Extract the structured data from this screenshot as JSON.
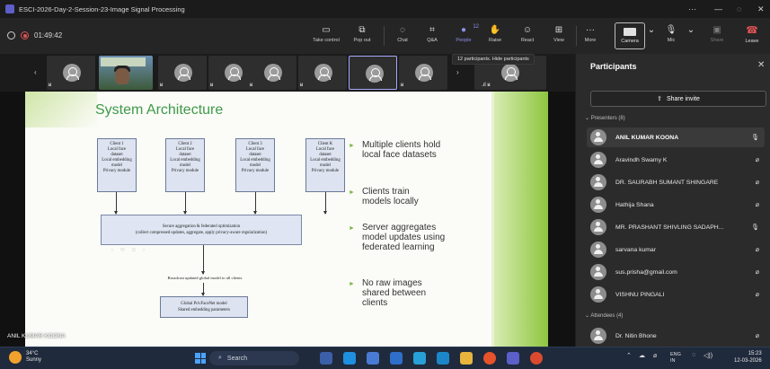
{
  "window": {
    "title": "ESCI-2026-Day-2-Session-23-Image Signal Processing",
    "controls": [
      "···",
      "—",
      "◌",
      "✕"
    ]
  },
  "toolbar": {
    "timer": "01:49:42",
    "take_control": "Take control",
    "pop_out": "Pop out",
    "chat": "Chat",
    "qa": "Q&A",
    "people": "People",
    "people_count": "12",
    "raise": "Raise",
    "react": "React",
    "view": "View",
    "more": "More",
    "camera": "Camera",
    "mic": "Mic",
    "share": "Share",
    "leave": "Leave",
    "tooltip": "12 participants. Hide participants"
  },
  "stage": {
    "speaker_name": "ANIL KUMAR KOONA"
  },
  "slide": {
    "title": "System Architecture",
    "clients": [
      {
        "name": "Client 1",
        "lines": [
          "Local face",
          "dataset",
          "Local embedding",
          "model",
          "Privacy module"
        ]
      },
      {
        "name": "Client 2",
        "lines": [
          "Local face",
          "dataset",
          "Local embedding",
          "model",
          "Privacy module"
        ]
      },
      {
        "name": "Client 3",
        "lines": [
          "Local face",
          "dataset",
          "Local embedding",
          "model",
          "Privacy module"
        ]
      },
      {
        "name": "Client K",
        "lines": [
          "Local face",
          "dataset",
          "Local embedding",
          "model",
          "Privacy module"
        ]
      }
    ],
    "aggregation_title": "Secure aggregation & federated optimization",
    "aggregation_sub": "(collect compressed updates, aggregate, apply privacy-aware regularization)",
    "broadcast": "Broadcast updated global model to all clients",
    "global_line1": "Global PrivFaceNet model",
    "global_line2": "Shared embedding parameters",
    "bullets": [
      "Multiple clients hold local face datasets",
      "Clients train models locally",
      "Server aggregates model updates using federated learning",
      "No raw images shared between clients"
    ]
  },
  "panel": {
    "title": "Participants",
    "share_invite": "Share invite",
    "presenters_label": "Presenters (8)",
    "attendees_label": "Attendees (4)",
    "presenters": [
      {
        "name": "ANIL KUMAR KOONA",
        "bold": true,
        "mic": "on"
      },
      {
        "name": "Aravindh Swamy K",
        "bold": false,
        "mic": "off"
      },
      {
        "name": "DR. SAURABH SUMANT SHINGARE",
        "bold": false,
        "mic": "off"
      },
      {
        "name": "Hathija Shana",
        "bold": false,
        "mic": "off"
      },
      {
        "name": "MR. PRASHANT SHIVLING SADAPH...",
        "bold": false,
        "mic": "on"
      },
      {
        "name": "sarvana kumar",
        "bold": false,
        "mic": "off"
      },
      {
        "name": "sus.prisha@gmail.com",
        "bold": false,
        "mic": "off"
      },
      {
        "name": "VISHNU PINGALI",
        "bold": false,
        "mic": "off"
      }
    ],
    "attendees": [
      {
        "name": "Dr. Nitin Bhone",
        "bold": false,
        "mic": "off"
      }
    ]
  },
  "taskbar": {
    "temperature": "34°C",
    "weather": "Sunny",
    "search": "Search",
    "lang1": "ENG",
    "lang2": "IN",
    "time": "15:23",
    "date": "12-03-2026"
  },
  "colors": {
    "accent": "#8b8fe8",
    "slide_title": "#3e9a49",
    "leave": "#e55353"
  }
}
